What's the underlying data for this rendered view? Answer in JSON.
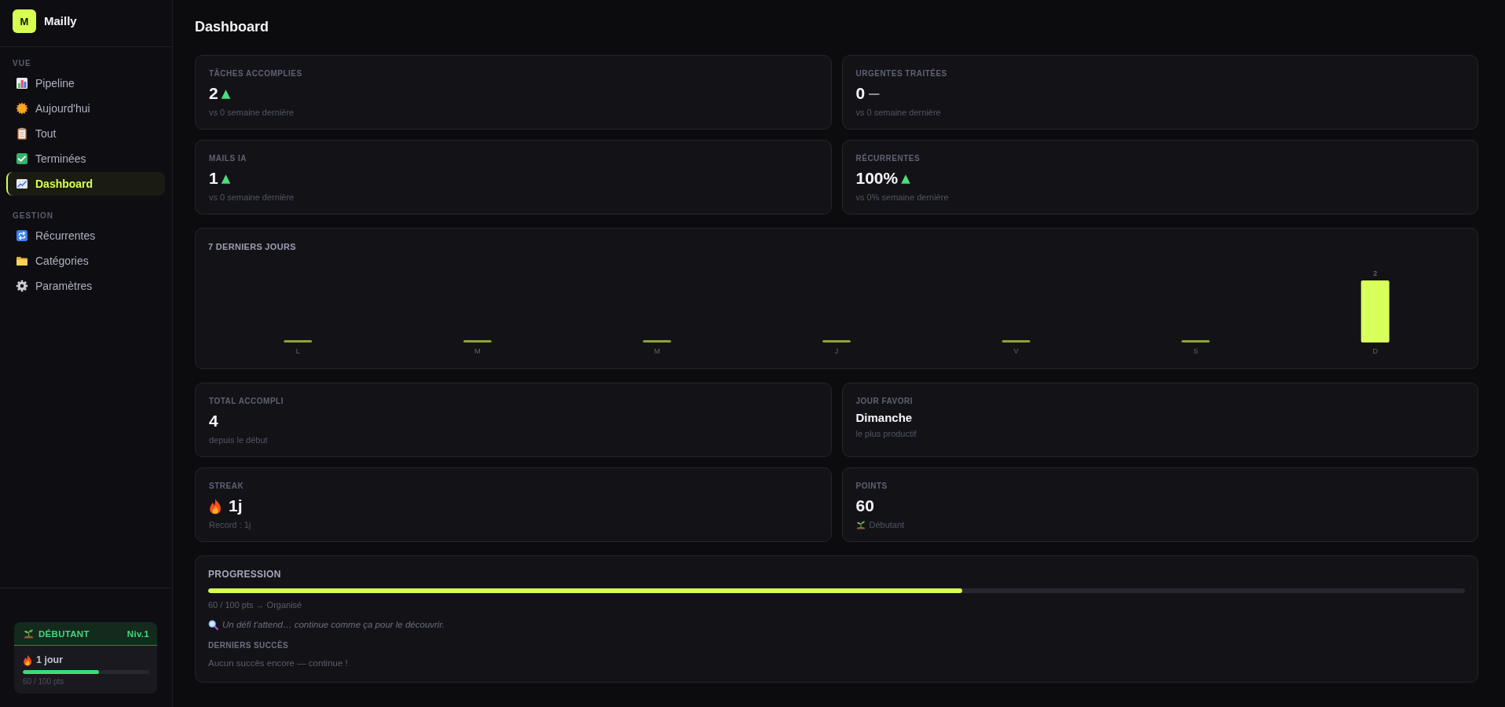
{
  "sidebar": {
    "logo": {
      "letter": "M",
      "name": "Mailly"
    },
    "sections": [
      {
        "label": "VUE",
        "items": [
          {
            "label": "Pipeline",
            "selected": false
          },
          {
            "label": "Aujourd'hui",
            "selected": false
          },
          {
            "label": "Tout",
            "selected": false
          },
          {
            "label": "Terminées",
            "selected": false
          },
          {
            "label": "Dashboard",
            "selected": true
          }
        ]
      },
      {
        "label": "GESTION",
        "items": [
          {
            "label": "Récurrentes",
            "selected": false
          },
          {
            "label": "Catégories",
            "selected": false
          },
          {
            "label": "Paramètres",
            "selected": false
          }
        ]
      }
    ],
    "badge": {
      "title": "DÉBUTANT",
      "rank": "Niv.1",
      "streak": "1 jour",
      "progress": {
        "level": 0.6,
        "reading": "60 / 100 pts"
      }
    }
  },
  "main": {
    "title": "Dashboard",
    "stats_top": [
      {
        "kind": "metric",
        "label": "TÂCHES ACCOMPLIES",
        "value": "2",
        "marker": "▲",
        "color": "#4ade80",
        "note": "vs 0 semaine dernière"
      },
      {
        "kind": "metric",
        "label": "URGENTES TRAITÉES",
        "value": "0",
        "marker": "—",
        "color": "#8b8d9a",
        "note": "vs 0 semaine dernière"
      },
      {
        "kind": "metric",
        "label": "MAILS IA",
        "value": "1",
        "marker": "▲",
        "color": "#4ade80",
        "note": "vs 0 semaine dernière"
      },
      {
        "kind": "metric",
        "label": "RÉCURRENTES",
        "value": "100%",
        "marker": "▲",
        "color": "#4ade80",
        "note": "vs 0% semaine dernière"
      }
    ],
    "chart": {
      "chart_data": {
        "type": "bar",
        "title": "7 DERNIERS JOURS",
        "categories": [
          "L",
          "M",
          "M",
          "J",
          "V",
          "S",
          "D"
        ],
        "values": [
          0,
          0,
          0,
          0,
          0,
          0,
          2
        ],
        "value_labels": [
          null,
          null,
          null,
          null,
          null,
          null,
          "2"
        ]
      }
    },
    "stats_bottom": [
      {
        "kind": "total",
        "label": "TOTAL ACCOMPLI",
        "value": "4",
        "note": "depuis le début"
      },
      {
        "kind": "day",
        "label": "JOUR FAVORI",
        "value": "Dimanche",
        "note": "le plus productif"
      },
      {
        "kind": "streak",
        "label": "STREAK",
        "value": "1j",
        "note": "Record : 1j"
      },
      {
        "kind": "points",
        "label": "POINTS",
        "value": "60",
        "note": "Débutant"
      }
    ],
    "progression": {
      "title": "PROGRESSION",
      "level": 0.6,
      "reading": "60 / 100 pts → Organisé",
      "hint": "Un défi t'attend… continue comme ça pour le découvrir.",
      "achievements_title": "DERNIERS SUCCÈS",
      "achievements_empty": "Aucun succès encore — continue !"
    }
  }
}
